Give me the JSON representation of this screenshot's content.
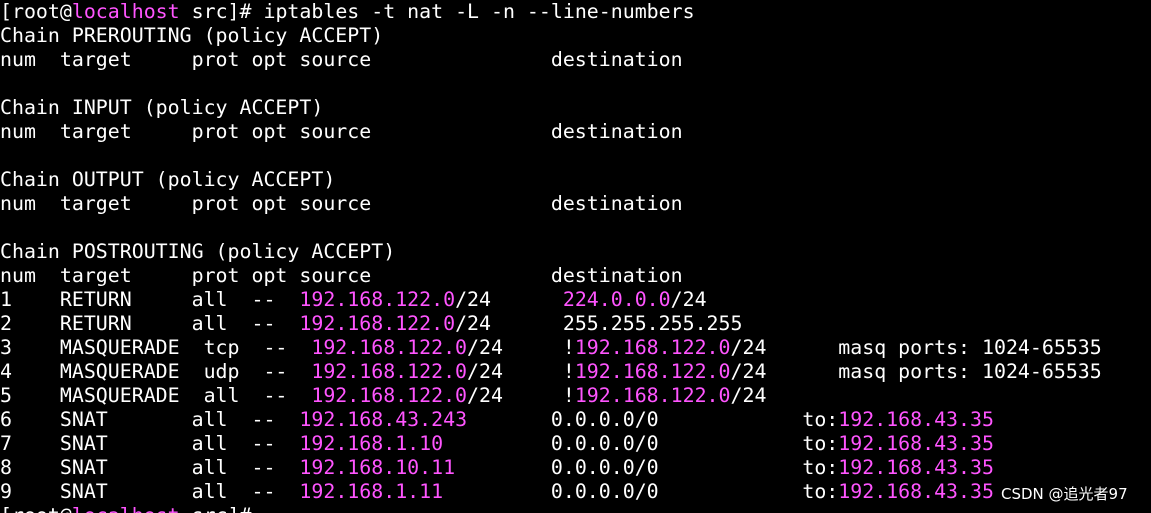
{
  "terminal": {
    "colors": {
      "background": "#000000",
      "text": "#ffffff",
      "highlight": "#ff55ff"
    },
    "lines": [
      [
        {
          "t": "[root@",
          "c": "w"
        },
        {
          "t": "localhost",
          "c": "m"
        },
        {
          "t": " src]# iptables -t nat -L -n --line-numbers",
          "c": "w"
        }
      ],
      [
        {
          "t": "Chain PREROUTING (policy ACCEPT)",
          "c": "w"
        }
      ],
      [
        {
          "t": "num  target     prot opt source               destination",
          "c": "w"
        }
      ],
      [
        {
          "t": "",
          "c": "w"
        }
      ],
      [
        {
          "t": "Chain INPUT (policy ACCEPT)",
          "c": "w"
        }
      ],
      [
        {
          "t": "num  target     prot opt source               destination",
          "c": "w"
        }
      ],
      [
        {
          "t": "",
          "c": "w"
        }
      ],
      [
        {
          "t": "Chain OUTPUT (policy ACCEPT)",
          "c": "w"
        }
      ],
      [
        {
          "t": "num  target     prot opt source               destination",
          "c": "w"
        }
      ],
      [
        {
          "t": "",
          "c": "w"
        }
      ],
      [
        {
          "t": "Chain POSTROUTING (policy ACCEPT)",
          "c": "w"
        }
      ],
      [
        {
          "t": "num  target     prot opt source               destination",
          "c": "w"
        }
      ],
      [
        {
          "t": "1    RETURN     all  --  ",
          "c": "w"
        },
        {
          "t": "192.168.122.0",
          "c": "m"
        },
        {
          "t": "/24      ",
          "c": "w"
        },
        {
          "t": "224.0.0.0",
          "c": "m"
        },
        {
          "t": "/24",
          "c": "w"
        }
      ],
      [
        {
          "t": "2    RETURN     all  --  ",
          "c": "w"
        },
        {
          "t": "192.168.122.0",
          "c": "m"
        },
        {
          "t": "/24      255.255.255.255",
          "c": "w"
        }
      ],
      [
        {
          "t": "3    MASQUERADE  tcp  --  ",
          "c": "w"
        },
        {
          "t": "192.168.122.0",
          "c": "m"
        },
        {
          "t": "/24     !",
          "c": "w"
        },
        {
          "t": "192.168.122.0",
          "c": "m"
        },
        {
          "t": "/24      masq ports: 1024-65535",
          "c": "w"
        }
      ],
      [
        {
          "t": "4    MASQUERADE  udp  --  ",
          "c": "w"
        },
        {
          "t": "192.168.122.0",
          "c": "m"
        },
        {
          "t": "/24     !",
          "c": "w"
        },
        {
          "t": "192.168.122.0",
          "c": "m"
        },
        {
          "t": "/24      masq ports: 1024-65535",
          "c": "w"
        }
      ],
      [
        {
          "t": "5    MASQUERADE  all  --  ",
          "c": "w"
        },
        {
          "t": "192.168.122.0",
          "c": "m"
        },
        {
          "t": "/24     !",
          "c": "w"
        },
        {
          "t": "192.168.122.0",
          "c": "m"
        },
        {
          "t": "/24",
          "c": "w"
        }
      ],
      [
        {
          "t": "6    SNAT       all  --  ",
          "c": "w"
        },
        {
          "t": "192.168.43.243",
          "c": "m"
        },
        {
          "t": "       0.0.0.0/0            to:",
          "c": "w"
        },
        {
          "t": "192.168.43.35",
          "c": "m"
        }
      ],
      [
        {
          "t": "7    SNAT       all  --  ",
          "c": "w"
        },
        {
          "t": "192.168.1.10",
          "c": "m"
        },
        {
          "t": "         0.0.0.0/0            to:",
          "c": "w"
        },
        {
          "t": "192.168.43.35",
          "c": "m"
        }
      ],
      [
        {
          "t": "8    SNAT       all  --  ",
          "c": "w"
        },
        {
          "t": "192.168.10.11",
          "c": "m"
        },
        {
          "t": "        0.0.0.0/0            to:",
          "c": "w"
        },
        {
          "t": "192.168.43.35",
          "c": "m"
        }
      ],
      [
        {
          "t": "9    SNAT       all  --  ",
          "c": "w"
        },
        {
          "t": "192.168.1.11",
          "c": "m"
        },
        {
          "t": "         0.0.0.0/0            to:",
          "c": "w"
        },
        {
          "t": "192.168.43.35",
          "c": "m"
        }
      ],
      [
        {
          "t": "[root@",
          "c": "w"
        },
        {
          "t": "localhost",
          "c": "m"
        },
        {
          "t": " src]#",
          "c": "w"
        }
      ]
    ]
  },
  "watermark": {
    "text": "CSDN @追光者97"
  }
}
